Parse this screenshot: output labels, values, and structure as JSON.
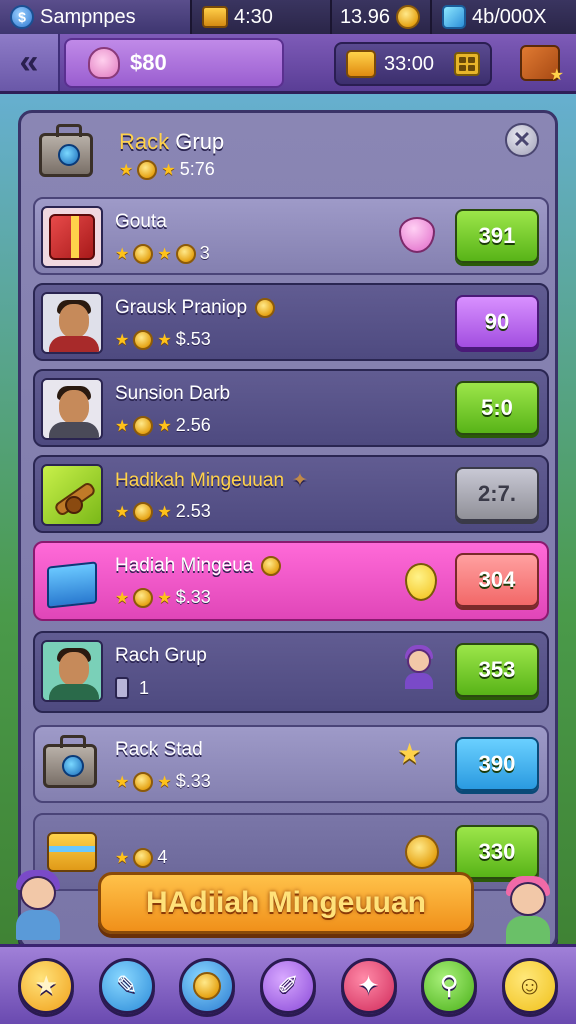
{
  "topbar": {
    "currency_label": "Sampnpes",
    "currency_icon": "$",
    "timer": "4:30",
    "coins": "13.96",
    "gems": "4b/000X"
  },
  "header": {
    "money": "$80",
    "chest_timer": "33:00"
  },
  "panel": {
    "title_a": "Rack",
    "title_b": "Grup",
    "subtitle": "5:76"
  },
  "rows": [
    {
      "title": "Gouta",
      "sub": "3",
      "price": "391"
    },
    {
      "title": "Grausk Praniop",
      "sub": "$.53",
      "price": "90"
    },
    {
      "title": "Sunsion Darb",
      "sub": "2.56",
      "price": "5:0"
    },
    {
      "title": "Hadikah Mingeuuan",
      "sub": "2.53",
      "price": "2:7."
    },
    {
      "title": "Hadiah Mingeua",
      "sub": "$.33",
      "price": "304"
    },
    {
      "title": "Rach Grup",
      "sub": "1",
      "price": "353"
    },
    {
      "title": "Rack Stad",
      "sub": "$.33",
      "price": "390"
    },
    {
      "title": "",
      "sub": "4",
      "price": "330"
    }
  ],
  "banner": {
    "label": "HAdiiah Mingeuuan"
  },
  "colors": {
    "accent_gold": "#ffd24a",
    "panel": "#8a86b4",
    "price_green": "#58b418",
    "price_purple": "#a24ee0",
    "highlight_pink": "#e046b8"
  },
  "nav": [
    "star-icon",
    "pencil-icon",
    "coin-icon",
    "brush-icon",
    "star-burst-icon",
    "key-icon",
    "smile-icon"
  ]
}
